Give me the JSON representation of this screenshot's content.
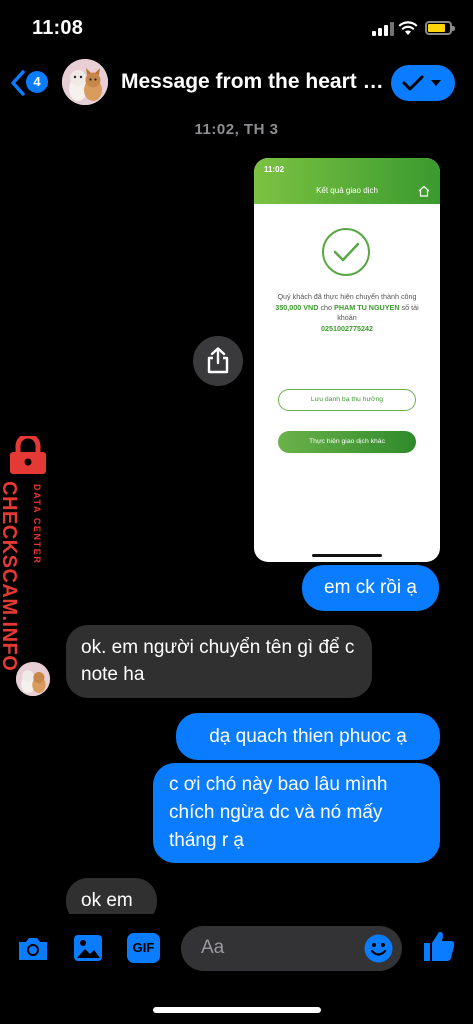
{
  "status_bar": {
    "time": "11:08"
  },
  "header": {
    "back_badge": "4",
    "title": "Message from the heart 🐶",
    "avatar_icon": "dog-avatar-icon",
    "accent": "#0a7cff"
  },
  "conversation": {
    "timestamp": "11:02, TH 3",
    "shared_image": {
      "time": "11:02",
      "title": "Kết quả giao dịch",
      "message_prefix": "Quý khách đã thực hiện chuyển thành công",
      "amount": "350,000 VND",
      "message_mid": "cho",
      "recipient": "PHAM TU NGUYEN",
      "message_suffix": "số tài khoản",
      "account_number": "0251002775242",
      "button_save": "Lưu danh bạ thụ hưởng",
      "button_new": "Thực hiện giao dịch khác",
      "brand_color": "#3a9a2e"
    },
    "messages": [
      {
        "direction": "outgoing",
        "text": "em ck rồi ạ"
      },
      {
        "direction": "incoming",
        "text": "ok. em người chuyển tên gì để c note ha"
      },
      {
        "direction": "outgoing",
        "text": "dạ quach thien phuoc ạ"
      },
      {
        "direction": "outgoing",
        "text": "c ơi chó này bao lâu mình chích ngừa dc và nó mấy tháng r ạ"
      },
      {
        "direction": "incoming",
        "text": "ok em"
      }
    ]
  },
  "watermark": {
    "main": "CHECKSCAM.INFO",
    "sub": "DATA CENTER",
    "color": "#e53935"
  },
  "composer": {
    "placeholder": "Aa",
    "gif_label": "GIF",
    "icons": [
      "camera-icon",
      "image-icon",
      "gif-icon",
      "emoji-icon",
      "thumbs-up-icon"
    ]
  }
}
